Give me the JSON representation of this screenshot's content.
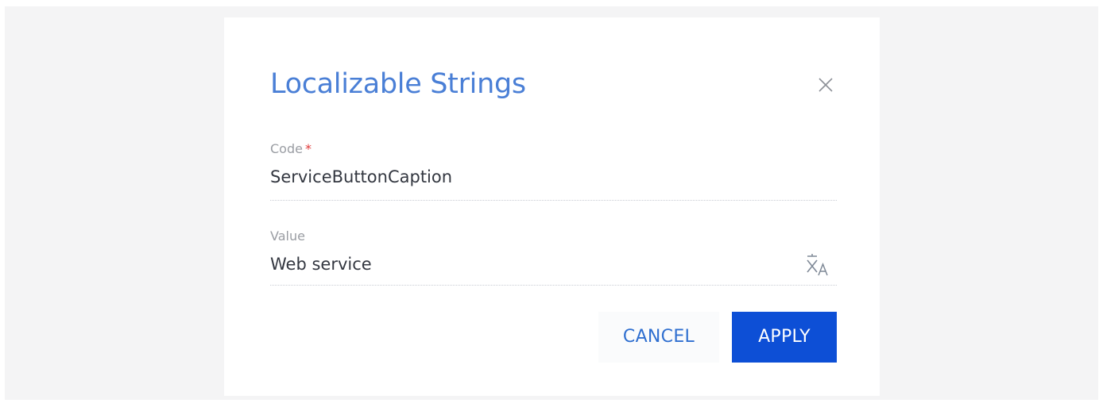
{
  "dialog": {
    "title": "Localizable Strings",
    "close_icon": "close-icon"
  },
  "fields": {
    "code": {
      "label": "Code",
      "required_mark": "*",
      "value": "ServiceButtonCaption"
    },
    "value": {
      "label": "Value",
      "value": "Web service",
      "translate_icon": "translate-icon"
    }
  },
  "actions": {
    "cancel_label": "CANCEL",
    "apply_label": "APPLY"
  },
  "colors": {
    "title": "#4a7fd6",
    "primary": "#0d4fd6",
    "required": "#e03a3a",
    "label": "#9a9da3",
    "text": "#333740",
    "backdrop": "#f4f4f5"
  }
}
